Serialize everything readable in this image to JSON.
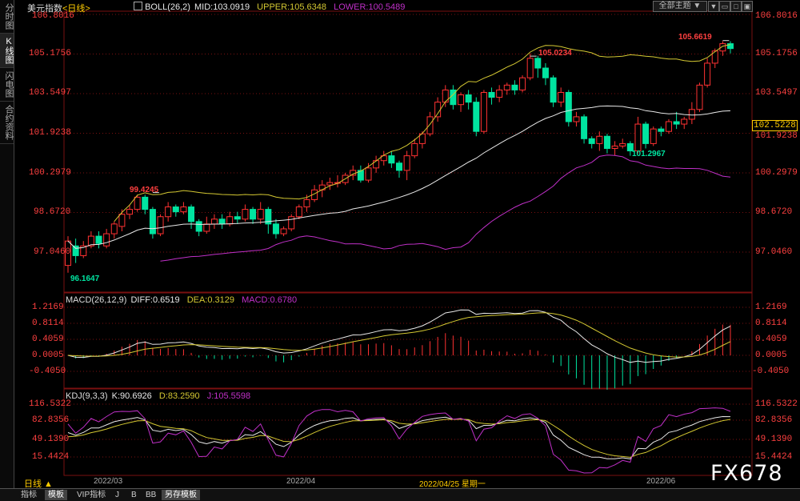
{
  "left_tabs": [
    "分时图",
    "K线图",
    "闪电图",
    "合约资料"
  ],
  "header": {
    "title": "美元指数",
    "period": "<日线>",
    "boll": {
      "label": "BOLL(26,2)",
      "mid": "MID:103.0919",
      "upper": "UPPER:105.6348",
      "lower": "LOWER:100.5489"
    },
    "theme_button": "全部主题",
    "window_buttons": [
      "▼",
      "▭",
      "□",
      "▣"
    ]
  },
  "colors": {
    "up": "#ff3232",
    "down": "#00e4a0",
    "mid": "#e8e8e8",
    "upper": "#d4c832",
    "lower": "#c030c8",
    "grid": "#7a1010",
    "text_red": "#ff4040"
  },
  "main_axis": {
    "ticks": [
      "106.8016",
      "105.1756",
      "103.5497",
      "101.9238",
      "100.2979",
      "98.6720",
      "97.0460"
    ],
    "current": "102.5228"
  },
  "annotations": {
    "high1": "99.4245",
    "high2": "105.0234",
    "high3": "105.6619",
    "low1": "96.1647",
    "low2": "101.2967"
  },
  "macd": {
    "label": "MACD(26,12,9)",
    "diff": "DIFF:0.6519",
    "dea": "DEA:0.3129",
    "macd": "MACD:0.6780",
    "ticks": [
      "1.2169",
      "0.8114",
      "0.4059",
      "0.0005",
      "-0.4050"
    ]
  },
  "kdj": {
    "label": "KDJ(9,3,3)",
    "k": "K:90.6926",
    "d": "D:83.2590",
    "j": "J:105.5598",
    "ticks": [
      "116.5322",
      "82.8356",
      "49.1390",
      "15.4424"
    ]
  },
  "dates": [
    "2022/03",
    "2022/04",
    "2022/04/25 星期一",
    "2022/06"
  ],
  "period_label": "日线 ▲",
  "bottom_tabs": [
    "指标",
    "模板",
    "VIP指标",
    "J",
    "B",
    "BB",
    "另存模板"
  ],
  "watermark": "FX678",
  "chart_data": {
    "type": "candlestick",
    "candles": [
      [
        96.5,
        97.5,
        96.2,
        97.7
      ],
      [
        97.3,
        96.9,
        96.6,
        97.6
      ],
      [
        96.9,
        97.3,
        96.8,
        97.5
      ],
      [
        97.3,
        97.7,
        97.2,
        97.9
      ],
      [
        97.7,
        97.4,
        97.2,
        97.9
      ],
      [
        97.3,
        97.8,
        97.2,
        98.0
      ],
      [
        97.8,
        98.2,
        97.6,
        98.3
      ],
      [
        98.1,
        98.6,
        97.9,
        98.8
      ],
      [
        98.6,
        98.8,
        98.4,
        99.0
      ],
      [
        98.8,
        99.3,
        98.7,
        99.4
      ],
      [
        99.3,
        98.8,
        98.6,
        99.4
      ],
      [
        98.8,
        97.8,
        97.6,
        98.9
      ],
      [
        97.8,
        98.5,
        97.7,
        98.6
      ],
      [
        98.5,
        98.9,
        98.3,
        99.1
      ],
      [
        98.9,
        98.7,
        98.5,
        99.0
      ],
      [
        98.7,
        98.9,
        98.6,
        99.1
      ],
      [
        98.9,
        98.3,
        98.0,
        99.0
      ],
      [
        98.3,
        97.9,
        97.7,
        98.4
      ],
      [
        97.9,
        98.2,
        97.8,
        98.5
      ],
      [
        98.2,
        98.4,
        98.0,
        98.6
      ],
      [
        98.4,
        98.2,
        98.0,
        98.6
      ],
      [
        98.2,
        98.5,
        98.1,
        98.7
      ],
      [
        98.5,
        98.4,
        98.2,
        98.7
      ],
      [
        98.4,
        98.8,
        98.3,
        99.0
      ],
      [
        98.8,
        98.4,
        98.2,
        98.9
      ],
      [
        98.4,
        98.8,
        98.2,
        99.1
      ],
      [
        98.8,
        98.2,
        97.8,
        98.9
      ],
      [
        98.2,
        97.8,
        97.6,
        98.4
      ],
      [
        97.8,
        98.0,
        97.7,
        98.1
      ],
      [
        98.0,
        98.5,
        97.9,
        98.6
      ],
      [
        98.5,
        98.9,
        98.4,
        99.0
      ],
      [
        98.9,
        99.2,
        98.7,
        99.4
      ],
      [
        99.2,
        99.6,
        99.1,
        99.8
      ],
      [
        99.6,
        99.8,
        99.3,
        100.0
      ],
      [
        99.8,
        99.9,
        99.6,
        100.1
      ],
      [
        99.9,
        99.9,
        99.7,
        100.2
      ],
      [
        99.9,
        100.2,
        99.8,
        100.3
      ],
      [
        100.2,
        100.4,
        100.0,
        100.6
      ],
      [
        100.4,
        100.0,
        99.9,
        100.6
      ],
      [
        100.0,
        100.5,
        99.9,
        100.7
      ],
      [
        100.5,
        100.8,
        100.3,
        101.0
      ],
      [
        100.8,
        101.0,
        100.6,
        101.2
      ],
      [
        101.0,
        100.7,
        100.5,
        101.2
      ],
      [
        100.7,
        100.4,
        100.1,
        100.8
      ],
      [
        100.4,
        101.0,
        100.0,
        101.2
      ],
      [
        101.0,
        101.5,
        100.9,
        101.7
      ],
      [
        101.5,
        101.9,
        101.3,
        102.0
      ],
      [
        101.9,
        102.6,
        101.8,
        102.8
      ],
      [
        102.6,
        103.2,
        102.4,
        103.4
      ],
      [
        103.2,
        103.7,
        103.0,
        103.9
      ],
      [
        103.7,
        103.1,
        102.9,
        103.9
      ],
      [
        103.1,
        103.5,
        102.8,
        103.6
      ],
      [
        103.5,
        103.2,
        102.9,
        103.7
      ],
      [
        103.2,
        102.0,
        101.8,
        103.4
      ],
      [
        102.0,
        103.6,
        101.9,
        103.7
      ],
      [
        103.6,
        103.4,
        103.1,
        103.8
      ],
      [
        103.4,
        103.7,
        103.2,
        103.9
      ],
      [
        103.7,
        103.9,
        103.5,
        104.0
      ],
      [
        103.9,
        103.7,
        103.5,
        104.1
      ],
      [
        103.7,
        104.2,
        103.6,
        104.3
      ],
      [
        104.2,
        105.0,
        104.1,
        105.2
      ],
      [
        105.0,
        104.6,
        104.2,
        105.1
      ],
      [
        104.6,
        104.2,
        103.9,
        104.8
      ],
      [
        104.2,
        103.2,
        103.0,
        104.3
      ],
      [
        103.2,
        103.6,
        103.0,
        103.8
      ],
      [
        103.6,
        102.4,
        102.2,
        103.7
      ],
      [
        102.4,
        102.6,
        102.2,
        102.8
      ],
      [
        102.6,
        101.7,
        101.5,
        102.7
      ],
      [
        101.7,
        101.5,
        101.3,
        101.8
      ],
      [
        101.5,
        101.8,
        101.2,
        102.0
      ],
      [
        101.8,
        101.3,
        101.1,
        101.9
      ],
      [
        101.3,
        101.4,
        101.0,
        101.6
      ],
      [
        101.4,
        101.5,
        101.3,
        101.7
      ],
      [
        101.5,
        101.2,
        101.0,
        101.6
      ],
      [
        101.2,
        102.3,
        101.1,
        102.6
      ],
      [
        102.3,
        101.5,
        101.3,
        102.4
      ],
      [
        101.5,
        102.1,
        101.4,
        102.2
      ],
      [
        102.1,
        102.0,
        101.8,
        102.2
      ],
      [
        102.0,
        102.4,
        101.9,
        102.5
      ],
      [
        102.4,
        102.3,
        102.1,
        102.8
      ],
      [
        102.3,
        102.5,
        102.1,
        102.6
      ],
      [
        102.5,
        102.9,
        102.3,
        103.2
      ],
      [
        102.9,
        103.9,
        102.8,
        104.0
      ],
      [
        103.9,
        104.8,
        103.8,
        105.0
      ],
      [
        104.8,
        105.3,
        104.6,
        105.4
      ],
      [
        105.3,
        105.6,
        105.1,
        105.7
      ],
      [
        105.6,
        105.4,
        105.2,
        105.7
      ]
    ],
    "title": "美元指数",
    "y_range": [
      95.8,
      107.0
    ]
  }
}
